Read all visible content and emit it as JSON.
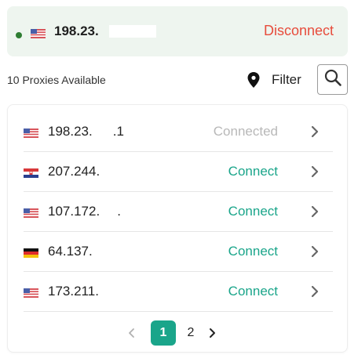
{
  "status_bar": {
    "indicator_color": "#2e7d32",
    "country_flag": "us-flag-icon",
    "ip": "198.23.",
    "disconnect_label": "Disconnect",
    "disconnect_color": "#e74c3c"
  },
  "toolbar": {
    "count_label": "10 Proxies Available",
    "filter_label": "Filter",
    "filter_icon": "location-pin-icon",
    "search_icon": "search-icon"
  },
  "proxies": [
    {
      "flag": "us-flag-icon",
      "ip": "198.23.",
      "suffix": ".1",
      "status": "Connected"
    },
    {
      "flag": "hr-flag-icon",
      "ip": "207.244.",
      "suffix": "",
      "status": "Connect"
    },
    {
      "flag": "us-flag-icon",
      "ip": "107.172.",
      "suffix": ".",
      "status": "Connect"
    },
    {
      "flag": "de-flag-icon",
      "ip": "64.137.",
      "suffix": "",
      "status": "Connect"
    },
    {
      "flag": "us-flag-icon",
      "ip": "173.211.",
      "suffix": "",
      "status": "Connect"
    }
  ],
  "pagination": {
    "pages": [
      "1",
      "2"
    ],
    "current_page": "1",
    "active_color": "#1aa58a"
  },
  "colors": {
    "accent": "#1aa58a",
    "muted": "#b8b8b8",
    "danger": "#e74c3c"
  }
}
